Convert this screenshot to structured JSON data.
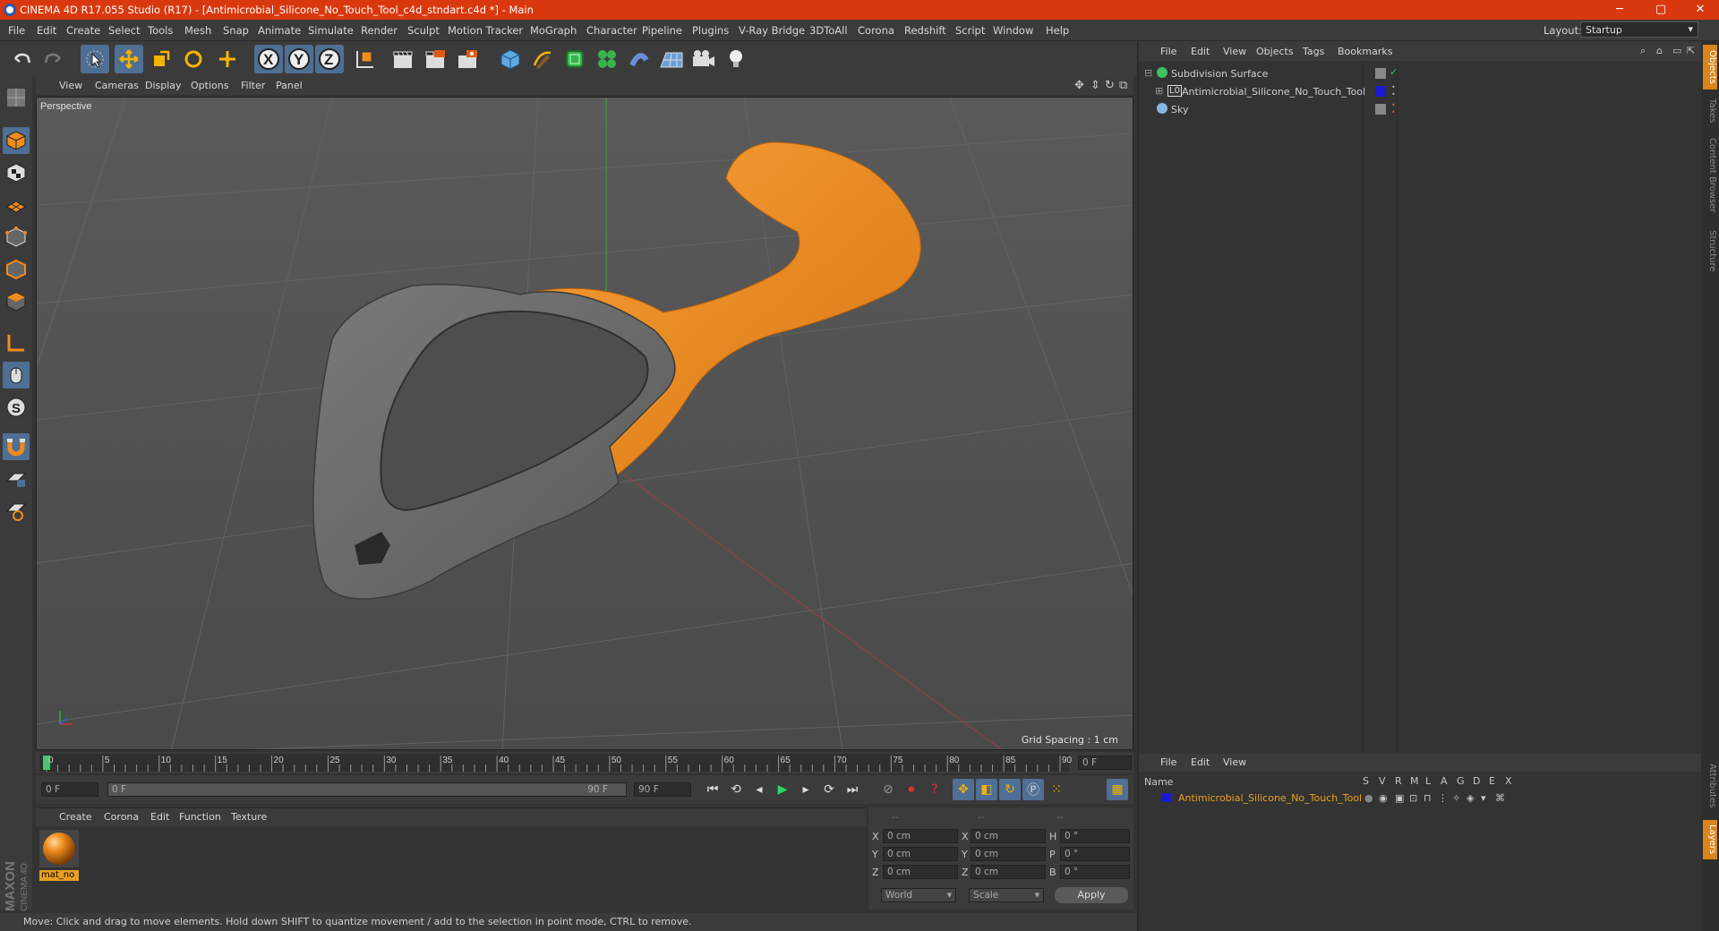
{
  "window": {
    "title": "CINEMA 4D R17.055 Studio (R17) - [Antimicrobial_Silicone_No_Touch_Tool_c4d_stndart.c4d *] - Main",
    "minimize": "─",
    "maximize": "▢",
    "close": "✕"
  },
  "menu": [
    "File",
    "Edit",
    "Create",
    "Select",
    "Tools",
    "Mesh",
    "Snap",
    "Animate",
    "Simulate",
    "Render",
    "Sculpt",
    "Motion Tracker",
    "MoGraph",
    "Character",
    "Pipeline",
    "Plugins",
    "V-Ray Bridge",
    "3DToAll",
    "Corona",
    "Redshift",
    "Script",
    "Window",
    "Help"
  ],
  "layout": {
    "label": "Layout:",
    "value": "Startup"
  },
  "viewport": {
    "menu": [
      "View",
      "Cameras",
      "Display",
      "Options",
      "Filter",
      "Panel"
    ],
    "label": "Perspective",
    "grid_spacing": "Grid Spacing : 1 cm"
  },
  "timeline": {
    "ticks": [
      "0",
      "5",
      "10",
      "15",
      "20",
      "25",
      "30",
      "35",
      "40",
      "45",
      "50",
      "55",
      "60",
      "65",
      "70",
      "75",
      "80",
      "85",
      "90"
    ],
    "current": "0 F",
    "start": "0 F",
    "range_start": "0 F",
    "range_end": "90 F",
    "end": "90 F"
  },
  "material": {
    "menu": [
      "Create",
      "Corona",
      "Edit",
      "Function",
      "Texture"
    ],
    "name": "mat_no"
  },
  "coords": {
    "headers": [
      "--",
      "--",
      "--"
    ],
    "rows": [
      {
        "a": "X",
        "av": "0 cm",
        "b": "X",
        "bv": "0 cm",
        "c": "H",
        "cv": "0 °"
      },
      {
        "a": "Y",
        "av": "0 cm",
        "b": "Y",
        "bv": "0 cm",
        "c": "P",
        "cv": "0 °"
      },
      {
        "a": "Z",
        "av": "0 cm",
        "b": "Z",
        "bv": "0 cm",
        "c": "B",
        "cv": "0 °"
      }
    ],
    "mode1": "World",
    "mode2": "Scale",
    "apply": "Apply"
  },
  "objects": {
    "menu": [
      "File",
      "Edit",
      "View",
      "Objects",
      "Tags",
      "Bookmarks"
    ],
    "items": [
      {
        "name": "Subdivision Surface"
      },
      {
        "name": "Antimicrobial_Silicone_No_Touch_Tool"
      },
      {
        "name": "Sky"
      }
    ]
  },
  "layers": {
    "menu": [
      "File",
      "Edit",
      "View"
    ],
    "name_header": "Name",
    "columns": [
      "S",
      "V",
      "R",
      "M",
      "L",
      "A",
      "G",
      "D",
      "E",
      "X"
    ],
    "row": "Antimicrobial_Silicone_No_Touch_Tool"
  },
  "right_tabs": [
    "Objects",
    "Takes",
    "Content Browser",
    "Structure",
    "Attributes",
    "Layers"
  ],
  "status": "Move: Click and drag to move elements. Hold down SHIFT to quantize movement / add to the selection in point mode, CTRL to remove.",
  "brand": {
    "line1": "MAXON",
    "line2": "CINEMA 4D"
  },
  "colors": {
    "accent": "#d9380f",
    "active_tool": "#4f6f94",
    "model_orange": "#f08c1c",
    "model_gray": "#6f6f6f"
  }
}
